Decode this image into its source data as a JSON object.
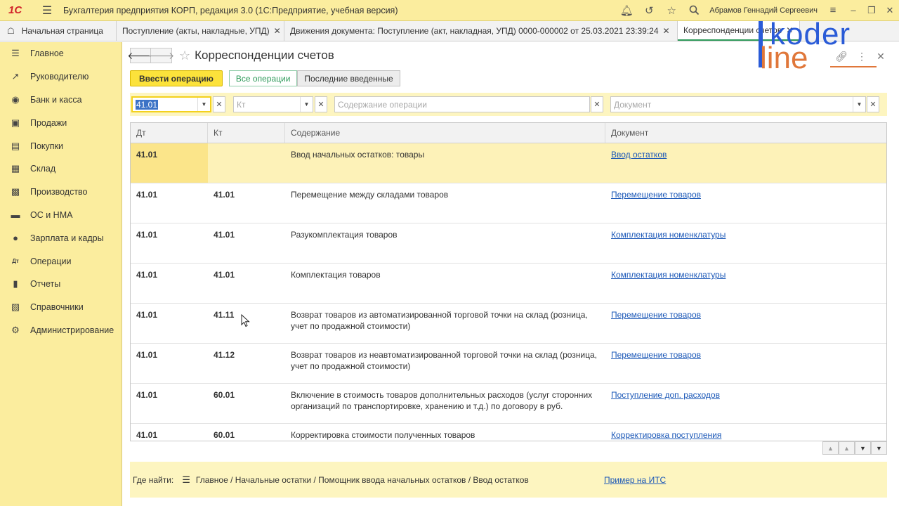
{
  "app": {
    "logo": "1С",
    "title": "Бухгалтерия предприятия КОРП, редакция 3.0  (1С:Предприятие, учебная версия)",
    "user": "Абрамов Геннадий Сергеевич"
  },
  "tabs": {
    "home_label": "Начальная страница",
    "items": [
      {
        "label": "Поступление (акты, накладные, УПД)"
      },
      {
        "label": "Движения документа: Поступление (акт, накладная, УПД) 0000-000002 от 25.03.2021 23:39:24"
      },
      {
        "label": "Корреспонденции счетов"
      }
    ]
  },
  "watermark": {
    "top": "koder",
    "bottom": "line"
  },
  "sidebar": {
    "items": [
      {
        "label": "Главное",
        "icon": "menu-icon"
      },
      {
        "label": "Руководителю",
        "icon": "chart-trend-icon"
      },
      {
        "label": "Банк и касса",
        "icon": "coin-icon"
      },
      {
        "label": "Продажи",
        "icon": "bag-icon"
      },
      {
        "label": "Покупки",
        "icon": "cart-icon"
      },
      {
        "label": "Склад",
        "icon": "grid-icon"
      },
      {
        "label": "Производство",
        "icon": "factory-icon"
      },
      {
        "label": "ОС и НМА",
        "icon": "car-icon"
      },
      {
        "label": "Зарплата и кадры",
        "icon": "person-icon"
      },
      {
        "label": "Операции",
        "icon": "dt-kt-icon"
      },
      {
        "label": "Отчеты",
        "icon": "bar-chart-icon"
      },
      {
        "label": "Справочники",
        "icon": "book-icon"
      },
      {
        "label": "Администрирование",
        "icon": "gear-icon"
      }
    ]
  },
  "form": {
    "title": "Корреспонденции счетов",
    "enter_operation": "Ввести операцию",
    "all_operations": "Все операции",
    "recent": "Последние введенные"
  },
  "filters": {
    "dt_value": "41.01",
    "kt_placeholder": "Кт",
    "content_placeholder": "Содержание операции",
    "document_placeholder": "Документ"
  },
  "table": {
    "headers": [
      "Дт",
      "Кт",
      "Содержание",
      "Документ"
    ],
    "rows": [
      {
        "dt": "41.01",
        "kt": "",
        "content": "Ввод начальных остатков: товары",
        "doc": "Ввод остатков"
      },
      {
        "dt": "41.01",
        "kt": "41.01",
        "content": "Перемещение между складами товаров",
        "doc": "Перемещение товаров"
      },
      {
        "dt": "41.01",
        "kt": "41.01",
        "content": "Разукомплектация товаров",
        "doc": "Комплектация номенклатуры"
      },
      {
        "dt": "41.01",
        "kt": "41.01",
        "content": "Комплектация товаров",
        "doc": "Комплектация номенклатуры"
      },
      {
        "dt": "41.01",
        "kt": "41.11",
        "content": "Возврат товаров из автоматизированной торговой точки на склад (розница, учет по продажной стоимости)",
        "doc": "Перемещение товаров"
      },
      {
        "dt": "41.01",
        "kt": "41.12",
        "content": "Возврат товаров из неавтоматизированной торговой точки на склад (розница, учет по продажной стоимости)",
        "doc": "Перемещение товаров"
      },
      {
        "dt": "41.01",
        "kt": "60.01",
        "content": "Включение в стоимость товаров дополнительных расходов (услуг сторонних организаций по транспортировке, хранению и т.д.) по договору в руб.",
        "doc": "Поступление доп. расходов"
      },
      {
        "dt": "41.01",
        "kt": "60.01",
        "content": "Корректировка стоимости полученных товаров",
        "doc": "Корректировка поступления"
      }
    ]
  },
  "where": {
    "label": "Где найти:",
    "path": "Главное / Начальные остатки / Помощник ввода начальных остатков / Ввод остатков",
    "link": "Пример на ИТС"
  }
}
